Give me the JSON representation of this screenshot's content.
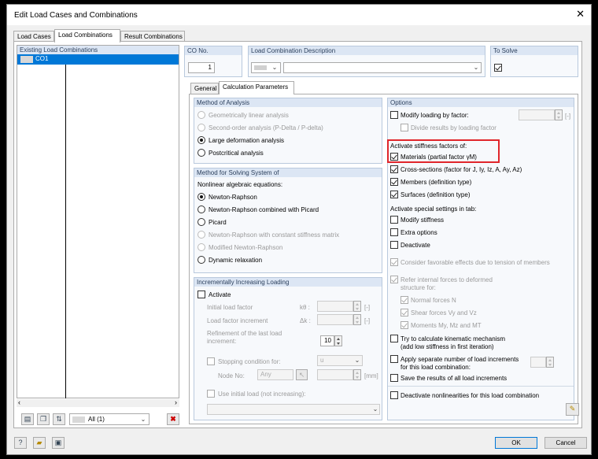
{
  "window": {
    "title": "Edit Load Cases and Combinations",
    "close_glyph": "✕"
  },
  "tabs": [
    {
      "label": "Load Cases",
      "active": false
    },
    {
      "label": "Load Combinations",
      "active": true
    },
    {
      "label": "Result Combinations",
      "active": false
    }
  ],
  "left_panel": {
    "header": "Existing Load Combinations",
    "items": [
      {
        "id": "CO1",
        "selected": true
      }
    ],
    "filter_value": "All (1)"
  },
  "co_no": {
    "label": "CO No.",
    "value": "1"
  },
  "description": {
    "label": "Load Combination Description",
    "value": ""
  },
  "to_solve": {
    "label": "To Solve",
    "checked": true
  },
  "subtabs": [
    {
      "label": "General",
      "active": false
    },
    {
      "label": "Calculation Parameters",
      "active": true
    }
  ],
  "method_of_analysis": {
    "header": "Method of Analysis",
    "options": [
      {
        "label": "Geometrically linear analysis",
        "selected": false,
        "disabled": true
      },
      {
        "label": "Second-order analysis (P-Delta / P-delta)",
        "selected": false,
        "disabled": true
      },
      {
        "label": "Large deformation analysis",
        "selected": true,
        "disabled": false
      },
      {
        "label": "Postcritical analysis",
        "selected": false,
        "disabled": false
      }
    ]
  },
  "solving_method": {
    "header": "Method for Solving System of",
    "subheader": "Nonlinear algebraic equations:",
    "options": [
      {
        "label": "Newton-Raphson",
        "selected": true,
        "disabled": false
      },
      {
        "label": "Newton-Raphson combined with Picard",
        "selected": false,
        "disabled": false
      },
      {
        "label": "Picard",
        "selected": false,
        "disabled": false
      },
      {
        "label": "Newton-Raphson with constant stiffness matrix",
        "selected": false,
        "disabled": true
      },
      {
        "label": "Modified Newton-Raphson",
        "selected": false,
        "disabled": true
      },
      {
        "label": "Dynamic relaxation",
        "selected": false,
        "disabled": false
      }
    ]
  },
  "incremental_loading": {
    "header": "Incrementally Increasing Loading",
    "activate_label": "Activate",
    "activate_checked": false,
    "initial_load_factor_label": "Initial load factor",
    "initial_load_factor_symbol": "kθ :",
    "initial_load_factor_unit": "[-]",
    "load_factor_increment_label": "Load factor increment",
    "load_factor_increment_symbol": "Δk :",
    "load_factor_increment_unit": "[-]",
    "refinement_label_1": "Refinement of the last load",
    "refinement_label_2": "increment:",
    "refinement_value": "10",
    "stopping_condition_label": "Stopping condition for:",
    "stopping_condition_value": "u",
    "node_no_label": "Node No:",
    "node_no_value": "Any",
    "node_unit": "[mm]",
    "use_initial_load_label": "Use initial load (not increasing):"
  },
  "options": {
    "header": "Options",
    "modify_loading_label": "Modify loading by factor:",
    "modify_loading_unit": "[-]",
    "divide_results_label": "Divide results by loading factor",
    "stiffness_header": "Activate stiffness factors of:",
    "stiffness_items": [
      {
        "label": "Materials (partial factor γM)",
        "checked": true
      },
      {
        "label": "Cross-sections (factor for J, Iy, Iz, A, Ay, Az)",
        "checked": true
      },
      {
        "label": "Members (definition type)",
        "checked": true
      },
      {
        "label": "Surfaces (definition type)",
        "checked": true
      }
    ],
    "special_header": "Activate special settings in tab:",
    "special_items": [
      {
        "label": "Modify stiffness",
        "checked": false
      },
      {
        "label": "Extra options",
        "checked": false
      },
      {
        "label": "Deactivate",
        "checked": false
      }
    ],
    "consider_favorable_label": "Consider favorable effects due to tension of members",
    "refer_internal_label_1": "Refer internal forces to deformed",
    "refer_internal_label_2": "structure for:",
    "normal_forces_label": "Normal forces N",
    "shear_forces_label": "Shear forces Vy and Vz",
    "moments_label": "Moments My, Mz and MT",
    "kinematic_label_1": "Try to calculate kinematic mechanism",
    "kinematic_label_2": "(add low stiffness in first iteration)",
    "separate_increments_label_1": "Apply separate number of load increments",
    "separate_increments_label_2": "for this load combination:",
    "save_results_label": "Save the results of all load increments",
    "deactivate_nonlinear_label": "Deactivate nonlinearities for this load combination"
  },
  "footer": {
    "ok_label": "OK",
    "cancel_label": "Cancel"
  },
  "colors": {
    "selection": "#0078d7",
    "highlight": "#e0262b",
    "group_header": "#dce6f4"
  }
}
